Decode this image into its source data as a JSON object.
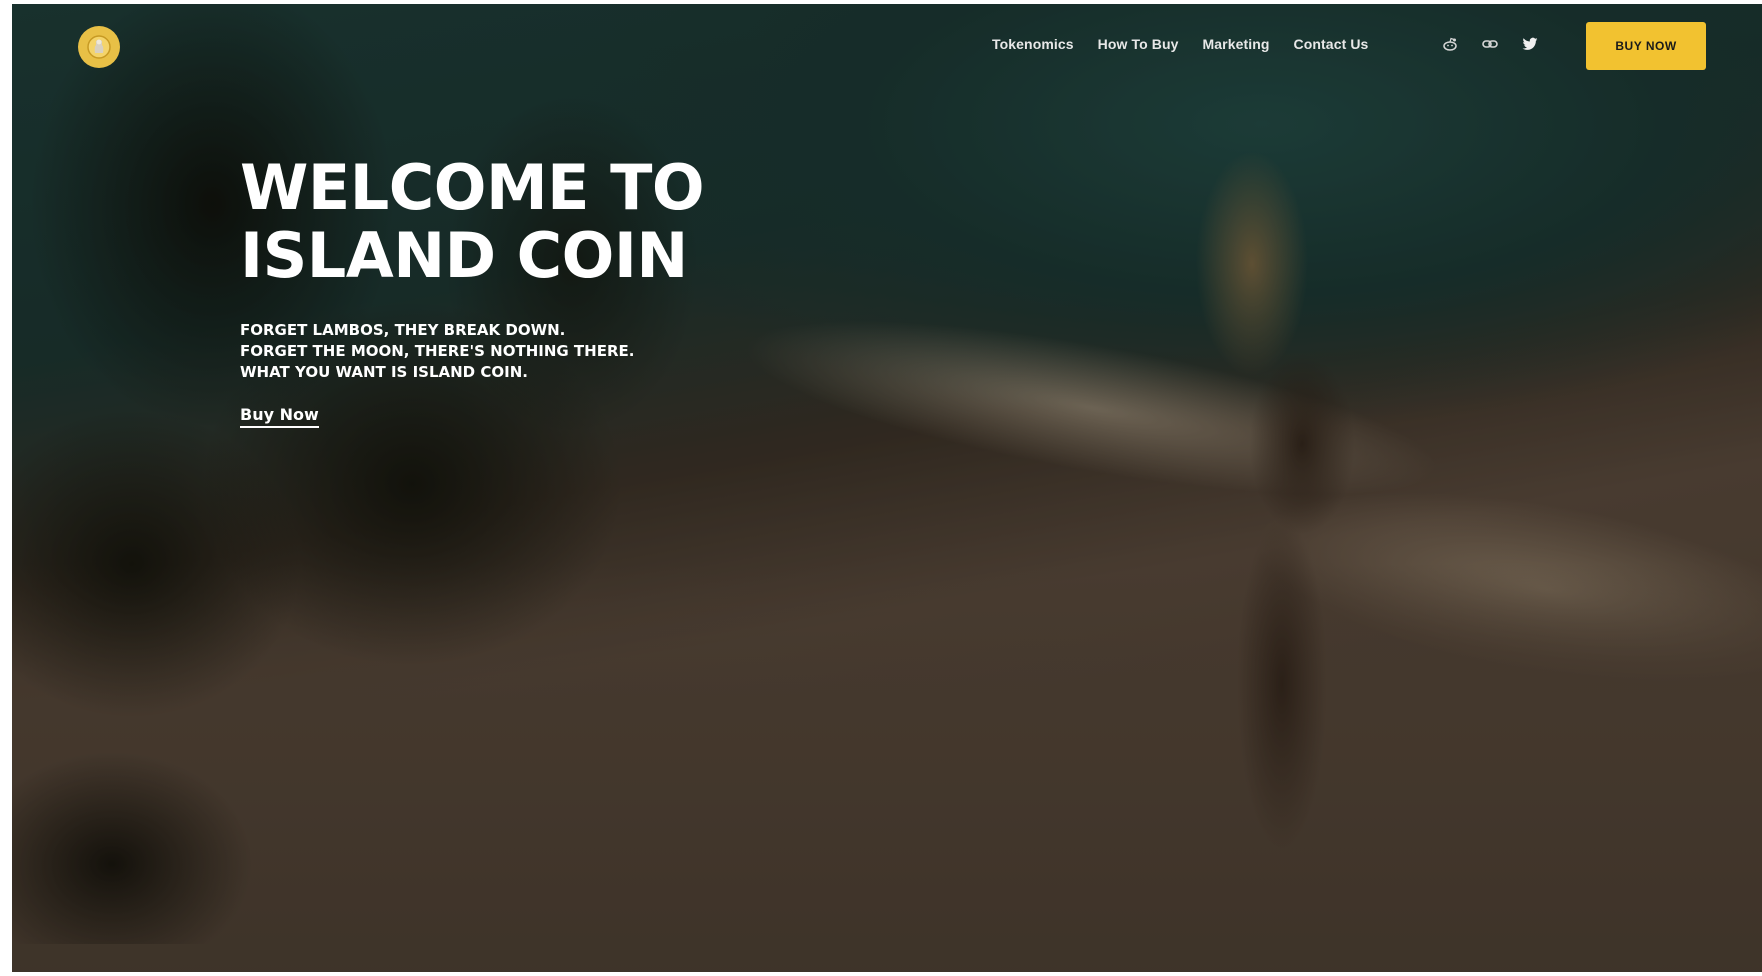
{
  "header": {
    "logo_icon": "island-coin-logo-icon",
    "nav": [
      {
        "label": "Tokenomics"
      },
      {
        "label": "How To Buy"
      },
      {
        "label": "Marketing"
      },
      {
        "label": "Contact Us"
      }
    ],
    "social": [
      {
        "icon": "reddit-icon"
      },
      {
        "icon": "link-icon"
      },
      {
        "icon": "twitter-icon"
      }
    ],
    "buy_button_label": "BUY NOW",
    "accent_color": "#f2c230"
  },
  "hero": {
    "title_line1": "WELCOME TO",
    "title_line2": "ISLAND COIN",
    "subtitle_lines": [
      "FORGET LAMBOS, THEY BREAK DOWN.",
      "FORGET THE MOON, THERE'S NOTHING THERE.",
      "WHAT YOU WANT IS ISLAND COIN."
    ],
    "cta_label": "Buy Now"
  }
}
